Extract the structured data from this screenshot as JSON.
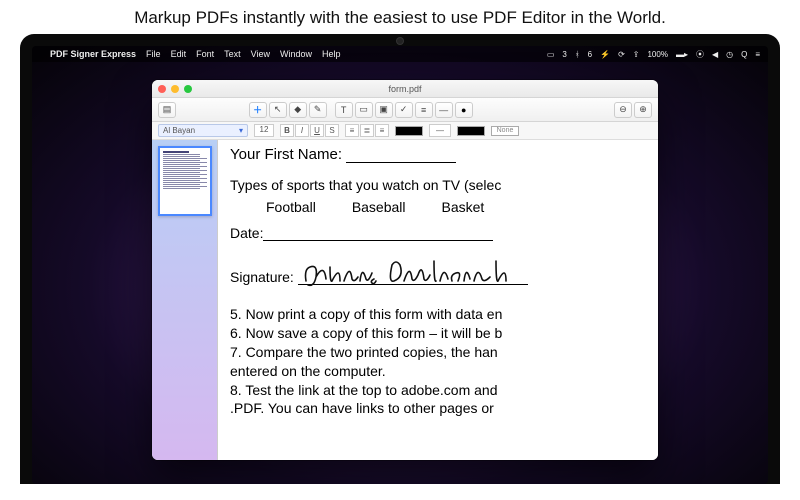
{
  "header": {
    "text": "Markup PDFs instantly with the easiest to use PDF Editor in the World."
  },
  "menubar": {
    "app_name": "PDF Signer Express",
    "items": [
      "File",
      "Edit",
      "Font",
      "Text",
      "View",
      "Window",
      "Help"
    ],
    "status_right": [
      "3",
      "6",
      "100%"
    ]
  },
  "window": {
    "title": "form.pdf",
    "formatbar": {
      "font_name": "Al Bayan",
      "font_size": "12",
      "fill_label": "None"
    }
  },
  "page": {
    "first_name_label": "Your First Name:",
    "sports_prompt": "Types of sports that you watch on TV (selec",
    "sports": [
      "Football",
      "Baseball",
      "Basket"
    ],
    "date_label": "Date:",
    "signature_label": "Signature:",
    "signature_value": "Johnny Appleseed",
    "numbered": [
      "5. Now print a copy of this form with data en",
      "6. Now save a copy of this form – it will be b",
      "7. Compare the two printed copies, the han",
      "entered on the computer.",
      "8. Test the link at the top to adobe.com and",
      ".PDF. You can have links to other pages or"
    ]
  }
}
